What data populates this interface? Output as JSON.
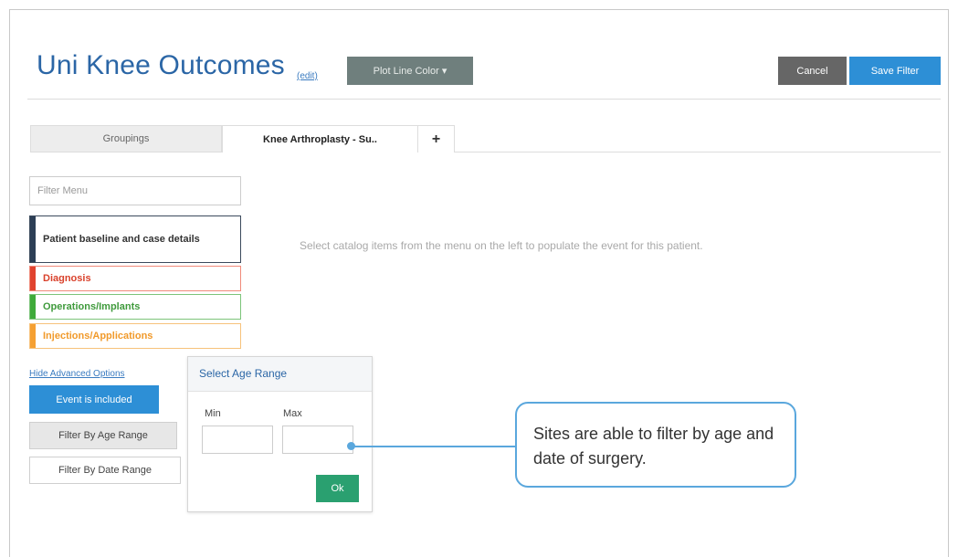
{
  "header": {
    "title": "Uni Knee Outcomes",
    "edit_label": "(edit)",
    "plot_line_color_label": "Plot Line Color ▾",
    "cancel_label": "Cancel",
    "save_label": "Save Filter"
  },
  "tabs": [
    {
      "label": "Groupings"
    },
    {
      "label": "Knee Arthroplasty - Su.."
    },
    {
      "label": "+"
    }
  ],
  "sidebar": {
    "filter_placeholder": "Filter Menu",
    "categories": [
      {
        "label": "Patient baseline and case details",
        "color": "#2c3e55"
      },
      {
        "label": "Diagnosis",
        "color": "#e0432f"
      },
      {
        "label": "Operations/Implants",
        "color": "#3faa3a"
      },
      {
        "label": "Injections/Applications",
        "color": "#f5a032"
      }
    ],
    "hide_advanced_label": "Hide Advanced Options",
    "event_included_label": "Event is included",
    "filter_age_label": "Filter By Age Range",
    "filter_date_label": "Filter By Date Range"
  },
  "main": {
    "empty_message": "Select catalog items from the menu on the left to populate the event for this patient."
  },
  "age_panel": {
    "title": "Select Age Range",
    "min_label": "Min",
    "max_label": "Max",
    "ok_label": "Ok"
  },
  "callout": {
    "text": "Sites are able to filter by age and date of surgery."
  },
  "colors": {
    "accent": "#2d8fd6",
    "title": "#2b66a6",
    "callout_border": "#5aa7dd",
    "ok": "#2aa070"
  }
}
